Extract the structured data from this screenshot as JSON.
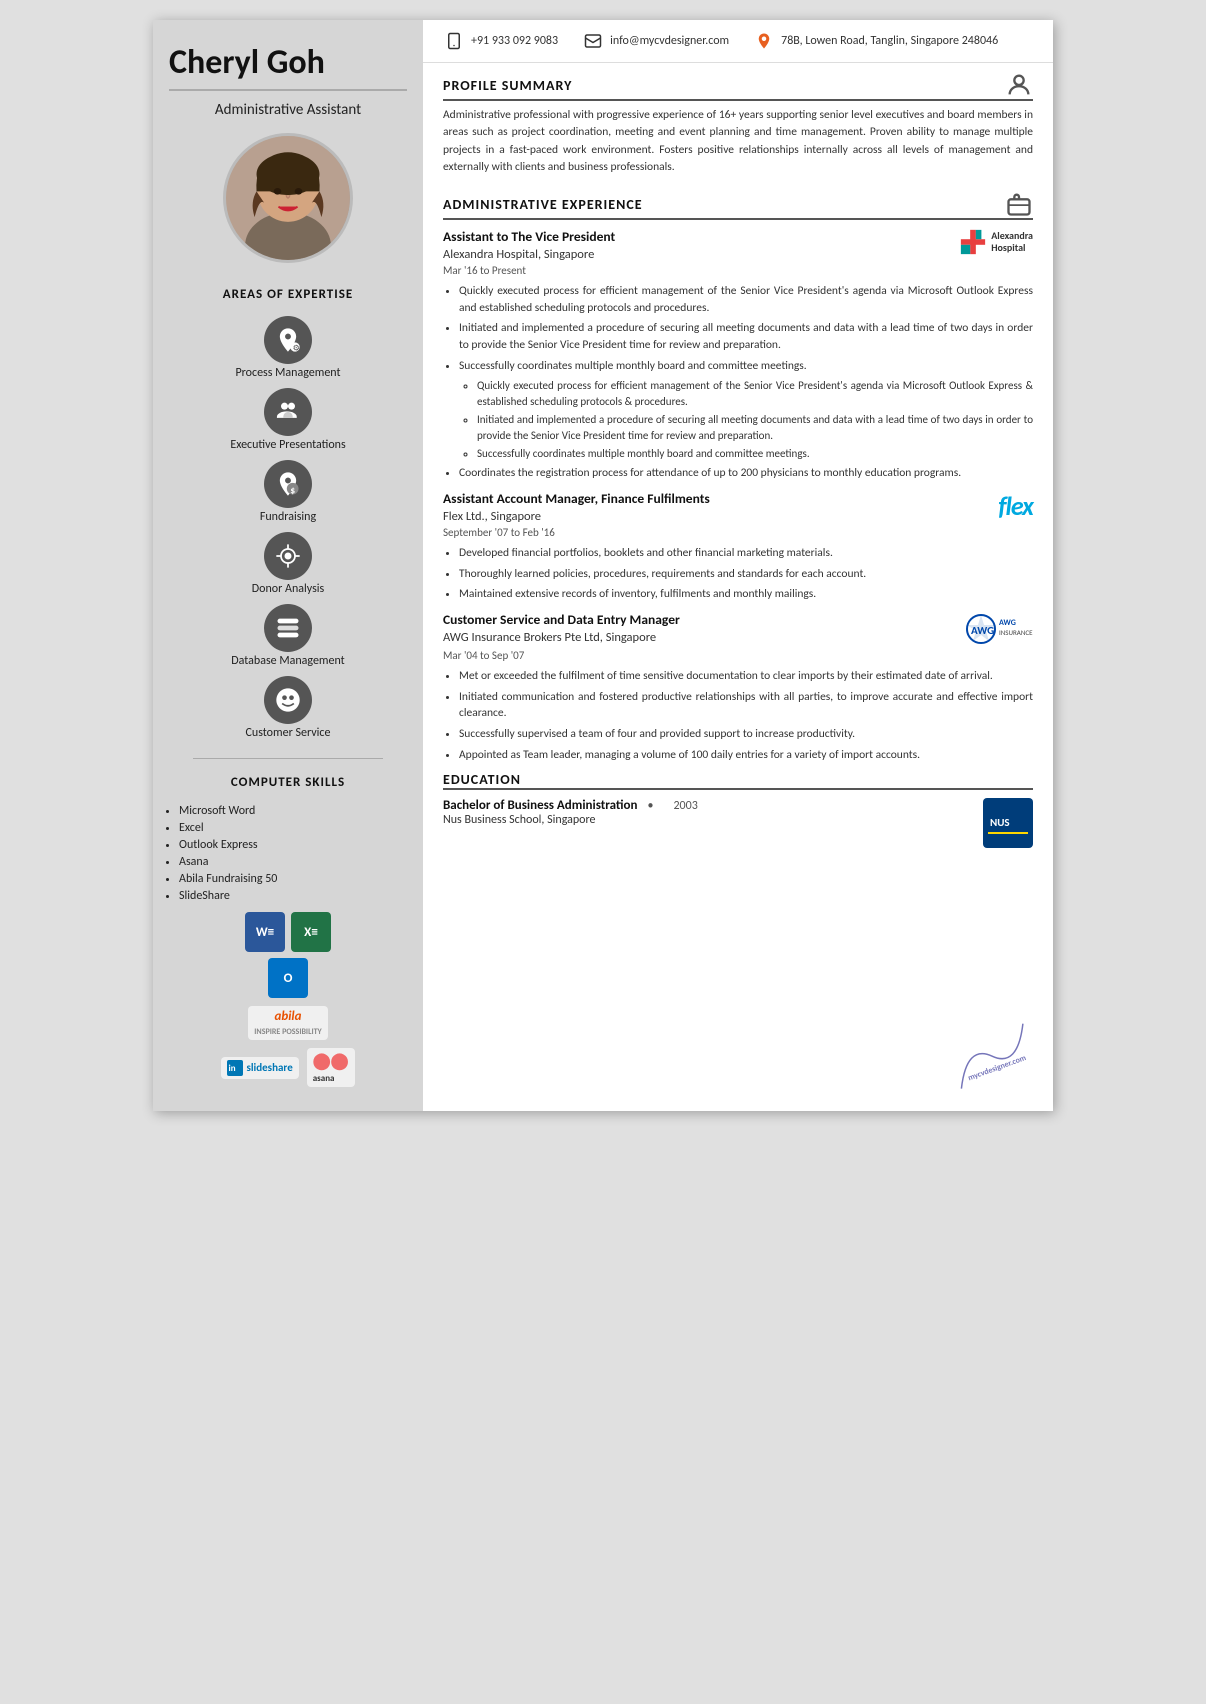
{
  "name": "Cheryl Goh",
  "title": "Administrative Assistant",
  "contact": {
    "phone": "+91 933 092 9083",
    "email": "info@mycvdesigner.com",
    "address": "78B, Lowen Road, Tanglin, Singapore 248046"
  },
  "profile_summary": {
    "section_title": "PROFILE SUMMARY",
    "text": "Administrative professional with progressive experience of 16+ years supporting senior level executives and board members in areas such as project coordination, meeting and event planning and time management. Proven ability to manage multiple projects in a fast-paced work environment. Fosters positive relationships internally across all levels of management and externally with clients and business professionals."
  },
  "areas_of_expertise": {
    "section_title": "AREAS OF EXPERTISE",
    "items": [
      "Process Management",
      "Executive Presentations",
      "Fundraising",
      "Donor Analysis",
      "Database Management",
      "Customer Service"
    ]
  },
  "computer_skills": {
    "section_title": "COMPUTER SKILLS",
    "items": [
      "Microsoft Word",
      "Excel",
      "Outlook Express",
      "Asana",
      "Abila Fundraising 50",
      "SlideShare"
    ]
  },
  "administrative_experience": {
    "section_title": "ADMINISTRATIVE EXPERIENCE",
    "jobs": [
      {
        "title": "Assistant to The Vice President",
        "company": "Alexandra Hospital, Singapore",
        "dates": "Mar '16 to Present",
        "logo": "alexandra",
        "bullets": [
          "Quickly executed process for efficient management of the Senior Vice President's agenda via Microsoft Outlook Express and established scheduling protocols and procedures.",
          "Initiated and implemented a procedure of securing all meeting documents and data with a lead time of two days in order to provide the Senior Vice President time for review and preparation.",
          "Successfully coordinates multiple monthly board and committee meetings."
        ],
        "sub_bullets": [
          "Quickly executed process for efficient management of the Senior Vice President's agenda via Microsoft Outlook Express & established scheduling protocols & procedures.",
          "Initiated and implemented a procedure of securing all meeting documents and data with a lead time of two days in order to provide the Senior Vice President time for review and preparation.",
          "Successfully coordinates multiple monthly board and committee meetings."
        ],
        "extra_bullet": "Coordinates the registration process for attendance of up to 200 physicians to monthly education programs."
      },
      {
        "title": "Assistant Account Manager, Finance Fulfilments",
        "company": "Flex Ltd., Singapore",
        "dates": "September '07 to Feb '16",
        "logo": "flex",
        "bullets": [
          "Developed financial portfolios, booklets and other financial marketing materials.",
          "Thoroughly learned policies, procedures, requirements and standards for each account.",
          "Maintained extensive records of inventory, fulfilments and monthly mailings."
        ],
        "sub_bullets": [],
        "extra_bullet": null
      },
      {
        "title": "Customer Service and Data Entry Manager",
        "company": "AWG Insurance Brokers Pte Ltd, Singapore",
        "dates": "Mar '04 to Sep '07",
        "logo": "awg",
        "bullets": [
          "Met or exceeded the fulfilment of time sensitive documentation to clear imports by their estimated date of arrival.",
          "Initiated communication and fostered productive relationships with all parties, to improve accurate and effective import clearance.",
          "Successfully supervised a team of four and provided support to increase productivity.",
          "Appointed as Team leader, managing a volume of 100 daily entries for a variety of import accounts."
        ],
        "sub_bullets": [],
        "extra_bullet": null
      }
    ]
  },
  "education": {
    "section_title": "EDUCATION",
    "entries": [
      {
        "degree": "Bachelor of Business Administration",
        "year": "2003",
        "school": "Nus Business School, Singapore"
      }
    ]
  }
}
